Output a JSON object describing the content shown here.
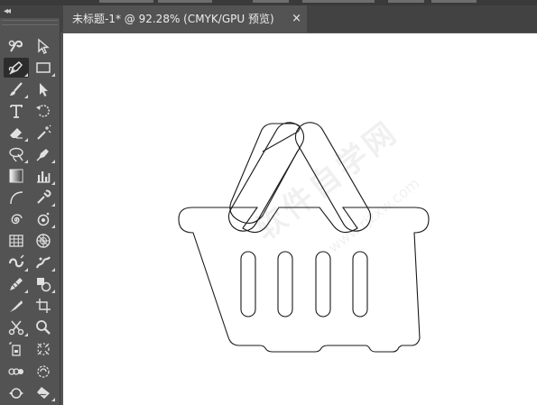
{
  "top_strip": {
    "label": ""
  },
  "panel": {
    "collapse_label": "◂◂"
  },
  "document": {
    "tab_title": "未标题-1* @ 92.28% (CMYK/GPU 预览)",
    "close_label": "×"
  },
  "canvas": {
    "artwork": "shopping-basket-outline",
    "watermark_text": "软件自学网",
    "watermark_url": "www.rjzxw.com"
  },
  "tools": [
    {
      "name": "selection-tool",
      "icon": "pen-curl-icon"
    },
    {
      "name": "direct-selection-tool",
      "icon": "arrow-pointer-icon"
    },
    {
      "name": "pen-tool",
      "icon": "pen-nib-icon",
      "active": true
    },
    {
      "name": "rectangle-tool",
      "icon": "rectangle-icon"
    },
    {
      "name": "paintbrush-tool",
      "icon": "brush-icon"
    },
    {
      "name": "direct-arrow-tool",
      "icon": "solid-arrow-icon"
    },
    {
      "name": "type-tool",
      "icon": "text-t-icon"
    },
    {
      "name": "rotate-tool",
      "icon": "rotate-icon"
    },
    {
      "name": "eraser-tool",
      "icon": "eraser-icon"
    },
    {
      "name": "magic-wand-tool",
      "icon": "magic-wand-icon"
    },
    {
      "name": "lasso-tool",
      "icon": "lasso-icon"
    },
    {
      "name": "pencil-tool",
      "icon": "pen-tip-icon"
    },
    {
      "name": "gradient-tool",
      "icon": "gradient-icon"
    },
    {
      "name": "graph-tool",
      "icon": "bar-graph-icon"
    },
    {
      "name": "arc-tool",
      "icon": "arc-icon"
    },
    {
      "name": "eyedropper-tool",
      "icon": "eyedropper-icon"
    },
    {
      "name": "spiral-tool",
      "icon": "spiral-icon"
    },
    {
      "name": "symbol-sprayer-tool",
      "icon": "sprayer-icon"
    },
    {
      "name": "grid-tool",
      "icon": "grid-icon"
    },
    {
      "name": "polar-grid-tool",
      "icon": "polar-grid-icon"
    },
    {
      "name": "blob-brush-tool",
      "icon": "blob-brush-icon"
    },
    {
      "name": "puppet-warp-tool",
      "icon": "puppet-icon"
    },
    {
      "name": "brush-pencil-tool",
      "icon": "pencil-icon"
    },
    {
      "name": "shape-builder-tool",
      "icon": "shape-builder-icon"
    },
    {
      "name": "knife-tool",
      "icon": "knife-icon"
    },
    {
      "name": "artboard-tool",
      "icon": "artboard-icon"
    },
    {
      "name": "scissors-tool",
      "icon": "scissors-icon"
    },
    {
      "name": "zoom-tool",
      "icon": "magnifier-icon"
    },
    {
      "name": "print-tiling-tool",
      "icon": "print-tiling-icon"
    },
    {
      "name": "perspective-tool",
      "icon": "perspective-icon"
    },
    {
      "name": "blend-tool",
      "icon": "blend-icon"
    },
    {
      "name": "live-paint-tool",
      "icon": "live-paint-icon"
    },
    {
      "name": "width-tool",
      "icon": "width-icon"
    },
    {
      "name": "warp-tool",
      "icon": "warp-icon"
    }
  ],
  "colors": {
    "panel_bg": "#535353",
    "tabbar_bg": "#424242",
    "canvas_bg": "#ffffff",
    "active_tool_bg": "#2c2c2c",
    "icon_color": "#e0e0e0"
  }
}
